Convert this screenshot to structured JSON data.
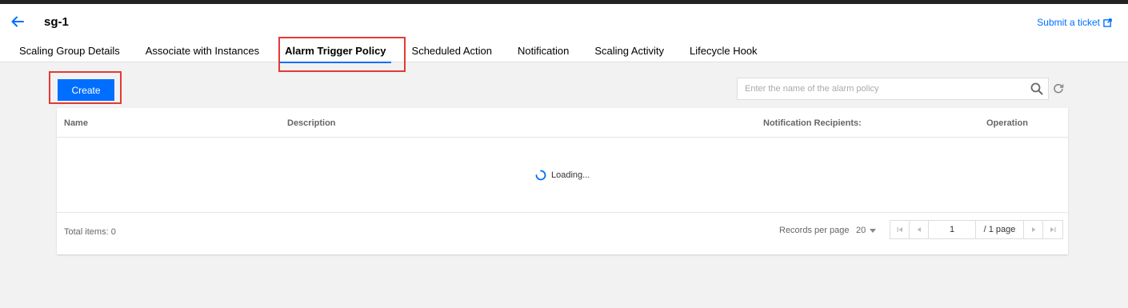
{
  "header": {
    "title": "sg-1",
    "ticket_label": "Submit a ticket"
  },
  "tabs": [
    {
      "label": "Scaling Group Details",
      "active": false
    },
    {
      "label": "Associate with Instances",
      "active": false
    },
    {
      "label": "Alarm Trigger Policy",
      "active": true
    },
    {
      "label": "Scheduled Action",
      "active": false
    },
    {
      "label": "Notification",
      "active": false
    },
    {
      "label": "Scaling Activity",
      "active": false
    },
    {
      "label": "Lifecycle Hook",
      "active": false
    }
  ],
  "toolbar": {
    "create_label": "Create",
    "search_placeholder": "Enter the name of the alarm policy"
  },
  "table": {
    "columns": [
      "Name",
      "Description",
      "Notification Recipients:",
      "Operation"
    ],
    "loading_text": "Loading..."
  },
  "footer": {
    "total_label": "Total items:",
    "total_count": "0",
    "records_label": "Records per page",
    "records_value": "20",
    "page_value": "1",
    "page_total": "/ 1 page"
  },
  "colors": {
    "accent": "#006eff",
    "highlight": "#e53935"
  }
}
